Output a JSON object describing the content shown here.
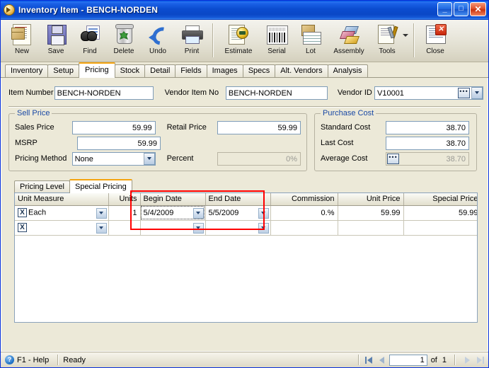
{
  "window": {
    "title": "Inventory Item  -  BENCH-NORDEN",
    "icon": "app-inventory-icon",
    "minimize_label": "_",
    "maximize_label": "□",
    "close_label": "✕"
  },
  "toolbar": {
    "items": [
      {
        "label": "New",
        "icon": "new-document-icon"
      },
      {
        "label": "Save",
        "icon": "floppy-disk-icon"
      },
      {
        "label": "Find",
        "icon": "binoculars-icon"
      },
      {
        "label": "Delete",
        "icon": "recycle-bin-icon"
      },
      {
        "label": "Undo",
        "icon": "undo-arrow-icon"
      },
      {
        "label": "Print",
        "icon": "printer-icon"
      },
      {
        "label": "Estimate",
        "icon": "estimate-seal-icon"
      },
      {
        "label": "Serial",
        "icon": "barcode-icon"
      },
      {
        "label": "Lot",
        "icon": "lot-box-icon"
      },
      {
        "label": "Assembly",
        "icon": "assembly-blocks-icon"
      },
      {
        "label": "Tools",
        "icon": "tools-wrench-icon"
      },
      {
        "label": "Close",
        "icon": "close-window-icon"
      }
    ]
  },
  "tabs": {
    "items": [
      {
        "label": "Inventory"
      },
      {
        "label": "Setup"
      },
      {
        "label": "Pricing"
      },
      {
        "label": "Stock"
      },
      {
        "label": "Detail"
      },
      {
        "label": "Fields"
      },
      {
        "label": "Images"
      },
      {
        "label": "Specs"
      },
      {
        "label": "Alt. Vendors"
      },
      {
        "label": "Analysis"
      }
    ],
    "active": "Pricing"
  },
  "header": {
    "item_number_label": "Item Number",
    "item_number_value": "BENCH-NORDEN",
    "vendor_item_no_label": "Vendor Item No",
    "vendor_item_no_value": "BENCH-NORDEN",
    "vendor_id_label": "Vendor ID",
    "vendor_id_value": "V10001",
    "ellipsis_label": "•••"
  },
  "sell_price": {
    "legend": "Sell Price",
    "sales_price_label": "Sales Price",
    "sales_price_value": "59.99",
    "retail_price_label": "Retail Price",
    "retail_price_value": "59.99",
    "msrp_label": "MSRP",
    "msrp_value": "59.99",
    "pricing_method_label": "Pricing Method",
    "pricing_method_value": "None",
    "percent_label": "Percent",
    "percent_value": "0%"
  },
  "purchase_cost": {
    "legend": "Purchase Cost",
    "standard_cost_label": "Standard Cost",
    "standard_cost_value": "38.70",
    "last_cost_label": "Last Cost",
    "last_cost_value": "38.70",
    "average_cost_label": "Average Cost",
    "average_cost_value": "38.70",
    "ellipsis_label": "•••"
  },
  "subtabs": {
    "items": [
      {
        "label": "Pricing Level"
      },
      {
        "label": "Special Pricing"
      }
    ],
    "active": "Special Pricing"
  },
  "grid": {
    "columns": [
      {
        "label": "Unit Measure",
        "align": "left"
      },
      {
        "label": "Units",
        "align": "right"
      },
      {
        "label": "Begin Date",
        "align": "left"
      },
      {
        "label": "End Date",
        "align": "left"
      },
      {
        "label": "Commission",
        "align": "right"
      },
      {
        "label": "Unit Price",
        "align": "right"
      },
      {
        "label": "Special Price",
        "align": "right"
      }
    ],
    "rows": [
      {
        "unit_measure": "Each",
        "units": "1",
        "begin_date": "5/4/2009",
        "end_date": "5/5/2009",
        "commission": "0.%",
        "unit_price": "59.99",
        "special_price": "59.99",
        "delete_label": "X"
      },
      {
        "unit_measure": "",
        "units": "",
        "begin_date": "",
        "end_date": "",
        "commission": "",
        "unit_price": "",
        "special_price": "",
        "delete_label": "X"
      }
    ]
  },
  "annotation": {
    "color": "#ff0000",
    "target": "begin-date-and-end-date-columns"
  },
  "statusbar": {
    "help_label": "F1 - Help",
    "help_icon": "question-mark-icon",
    "status_text": "Ready",
    "record_value": "1",
    "of_label": "of",
    "record_total": "1"
  }
}
